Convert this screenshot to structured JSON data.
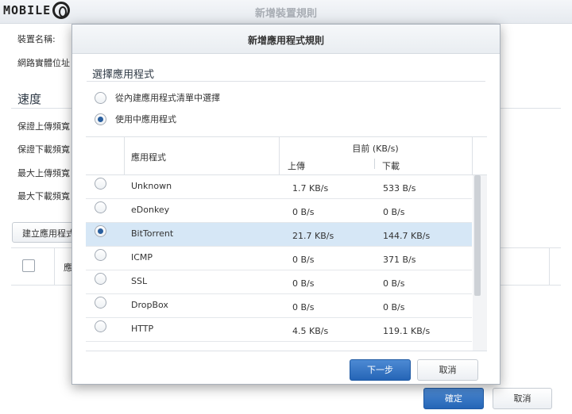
{
  "watermark": {
    "text": "MOBILE"
  },
  "outer_dialog": {
    "title": "新增裝置規則",
    "labels": {
      "device_name": "裝置名稱:",
      "mac_address": "網路實體位址",
      "speed_section": "速度",
      "guaranteed_upload": "保證上傳頻寬",
      "guaranteed_download": "保證下載頻寬",
      "max_upload": "最大上傳頻寬",
      "max_download": "最大下載頻寬"
    },
    "create_app_rule_button": "建立應用程式",
    "table_header_app": "應用",
    "ok_button": "確定",
    "cancel_button": "取消"
  },
  "modal": {
    "title": "新增應用程式規則",
    "section_title": "選擇應用程式",
    "options": [
      {
        "label": "從內建應用程式清單中選擇",
        "selected": false
      },
      {
        "label": "使用中應用程式",
        "selected": true
      }
    ],
    "table": {
      "col_app": "應用程式",
      "col_current": "目前 (KB/s)",
      "col_upload": "上傳",
      "col_download": "下載",
      "rows": [
        {
          "name": "Unknown",
          "upload": "1.7 KB/s",
          "download": "533 B/s",
          "selected": false
        },
        {
          "name": "eDonkey",
          "upload": "0 B/s",
          "download": "0 B/s",
          "selected": false
        },
        {
          "name": "BitTorrent",
          "upload": "21.7 KB/s",
          "download": "144.7 KB/s",
          "selected": true
        },
        {
          "name": "ICMP",
          "upload": "0 B/s",
          "download": "371 B/s",
          "selected": false
        },
        {
          "name": "SSL",
          "upload": "0 B/s",
          "download": "0 B/s",
          "selected": false
        },
        {
          "name": "DropBox",
          "upload": "0 B/s",
          "download": "0 B/s",
          "selected": false
        },
        {
          "name": "HTTP",
          "upload": "4.5 KB/s",
          "download": "119.1 KB/s",
          "selected": false
        }
      ]
    },
    "next_button": "下一步",
    "cancel_button": "取消"
  },
  "colors": {
    "primary_button": "#2f6fc0",
    "selected_row": "#d6e7f6",
    "radio_dot": "#2a5f9e"
  }
}
